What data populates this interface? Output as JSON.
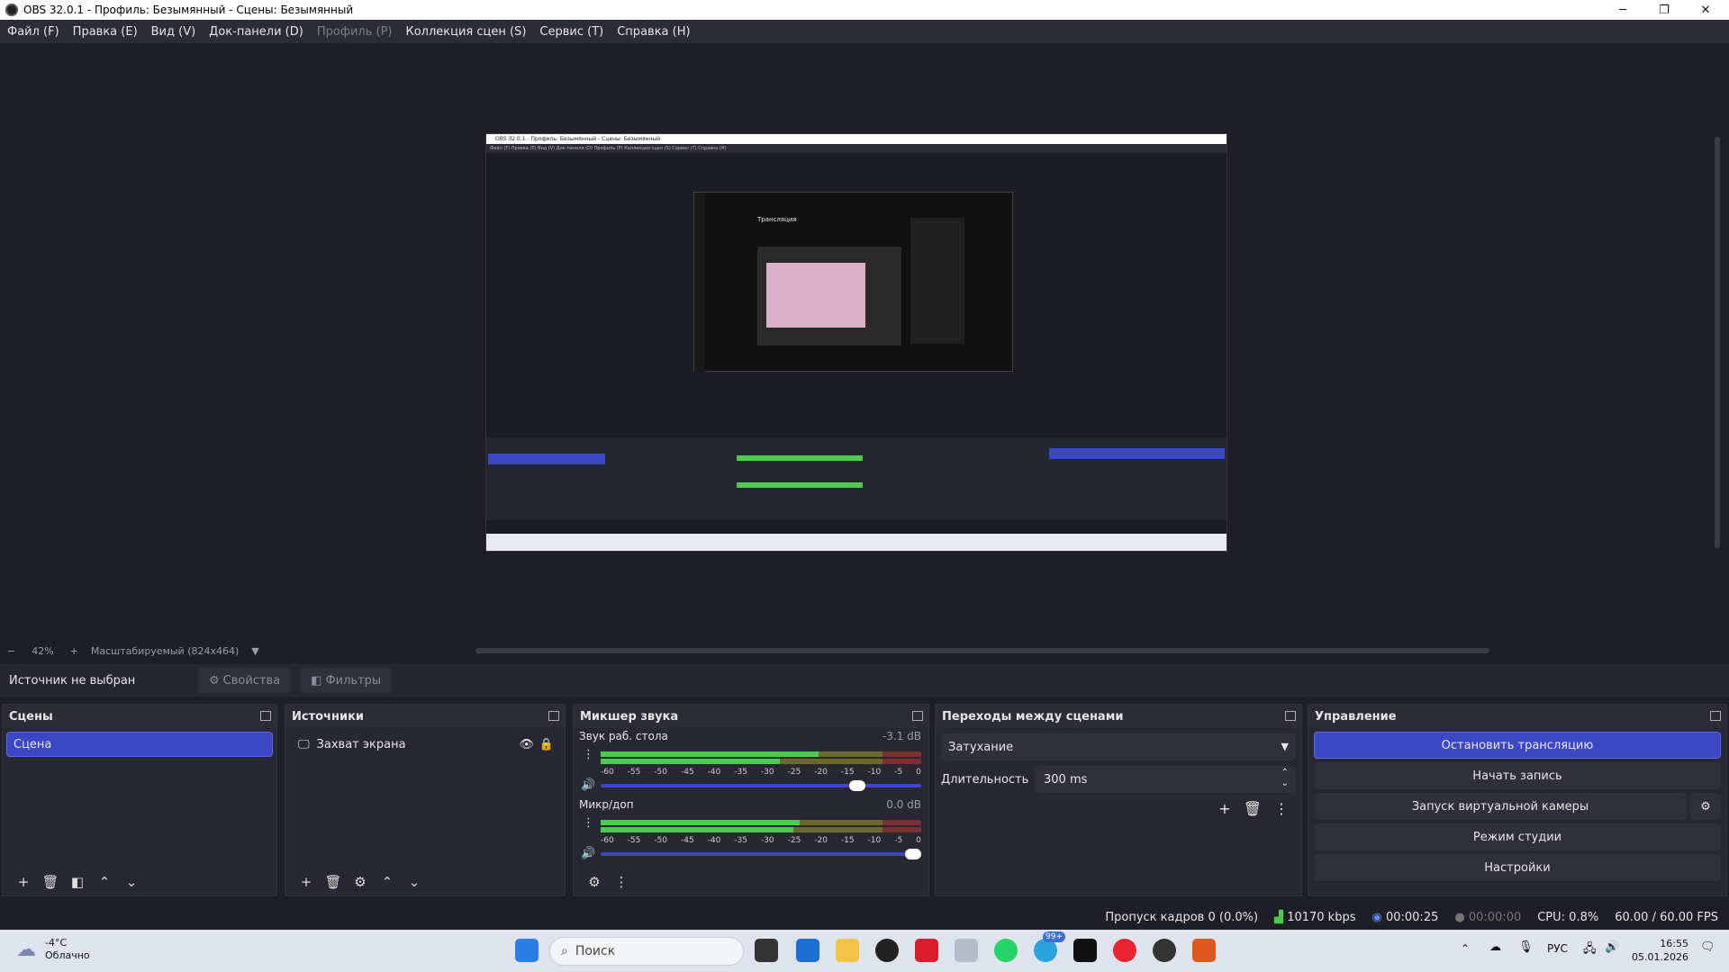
{
  "window": {
    "title": "OBS 32.0.1 - Профиль: Безымянный - Сцены: Безымянный",
    "minimize": "─",
    "maximize": "❐",
    "close": "✕"
  },
  "menu": [
    "Файл (F)",
    "Правка (E)",
    "Вид (V)",
    "Док-панели (D)",
    "Профиль (P)",
    "Коллекция сцен (S)",
    "Сервис (T)",
    "Справка (H)"
  ],
  "preview": {
    "mini_title": "OBS 32.0.1 - Профиль: Безымянный - Сцены: Безымянный",
    "mini_heading": "Трансляция"
  },
  "zoom": {
    "minus": "−",
    "value": "42%",
    "plus": "+",
    "mode": "Масштабируемый (824x464)"
  },
  "source_toolbar": {
    "status": "Источник не выбран",
    "properties": "Свойства",
    "filters": "Фильтры"
  },
  "scenes": {
    "title": "Сцены",
    "items": [
      "Сцена"
    ]
  },
  "sources": {
    "title": "Источники",
    "items": [
      "Захват экрана"
    ]
  },
  "mixer": {
    "title": "Микшер звука",
    "channels": [
      {
        "name": "Звук раб. стола",
        "db": "-3.1 dB",
        "volume": 0.8
      },
      {
        "name": "Микр/доп",
        "db": "0.0 dB",
        "volume": 1.0
      }
    ],
    "scale": [
      "-60",
      "-55",
      "-50",
      "-45",
      "-40",
      "-35",
      "-30",
      "-25",
      "-20",
      "-15",
      "-10",
      "-5",
      "0"
    ]
  },
  "transitions": {
    "title": "Переходы между сценами",
    "selected": "Затухание",
    "duration_label": "Длительность",
    "duration_value": "300 ms"
  },
  "controls": {
    "title": "Управление",
    "stop_stream": "Остановить трансляцию",
    "start_record": "Начать запись",
    "virtual_cam": "Запуск виртуальной камеры",
    "studio_mode": "Режим студии",
    "settings": "Настройки"
  },
  "status": {
    "dropped": "Пропуск кадров 0 (0.0%)",
    "bitrate": "10170 kbps",
    "stream_time": "00:00:25",
    "rec_time": "00:00:00",
    "cpu": "CPU: 0.8%",
    "fps": "60.00 / 60.00 FPS"
  },
  "taskbar": {
    "weather_temp": "-4°C",
    "weather_desc": "Облачно",
    "search_placeholder": "Поиск",
    "badge": "99+",
    "lang": "РУС",
    "time": "16:55",
    "date": "05.01.2026"
  },
  "colors": {
    "accent": "#3c47c4",
    "background": "#1e1f26",
    "meter_green": "#4ccc4c",
    "meter_yellow": "#c8c84c",
    "meter_red": "#c84c4c"
  }
}
